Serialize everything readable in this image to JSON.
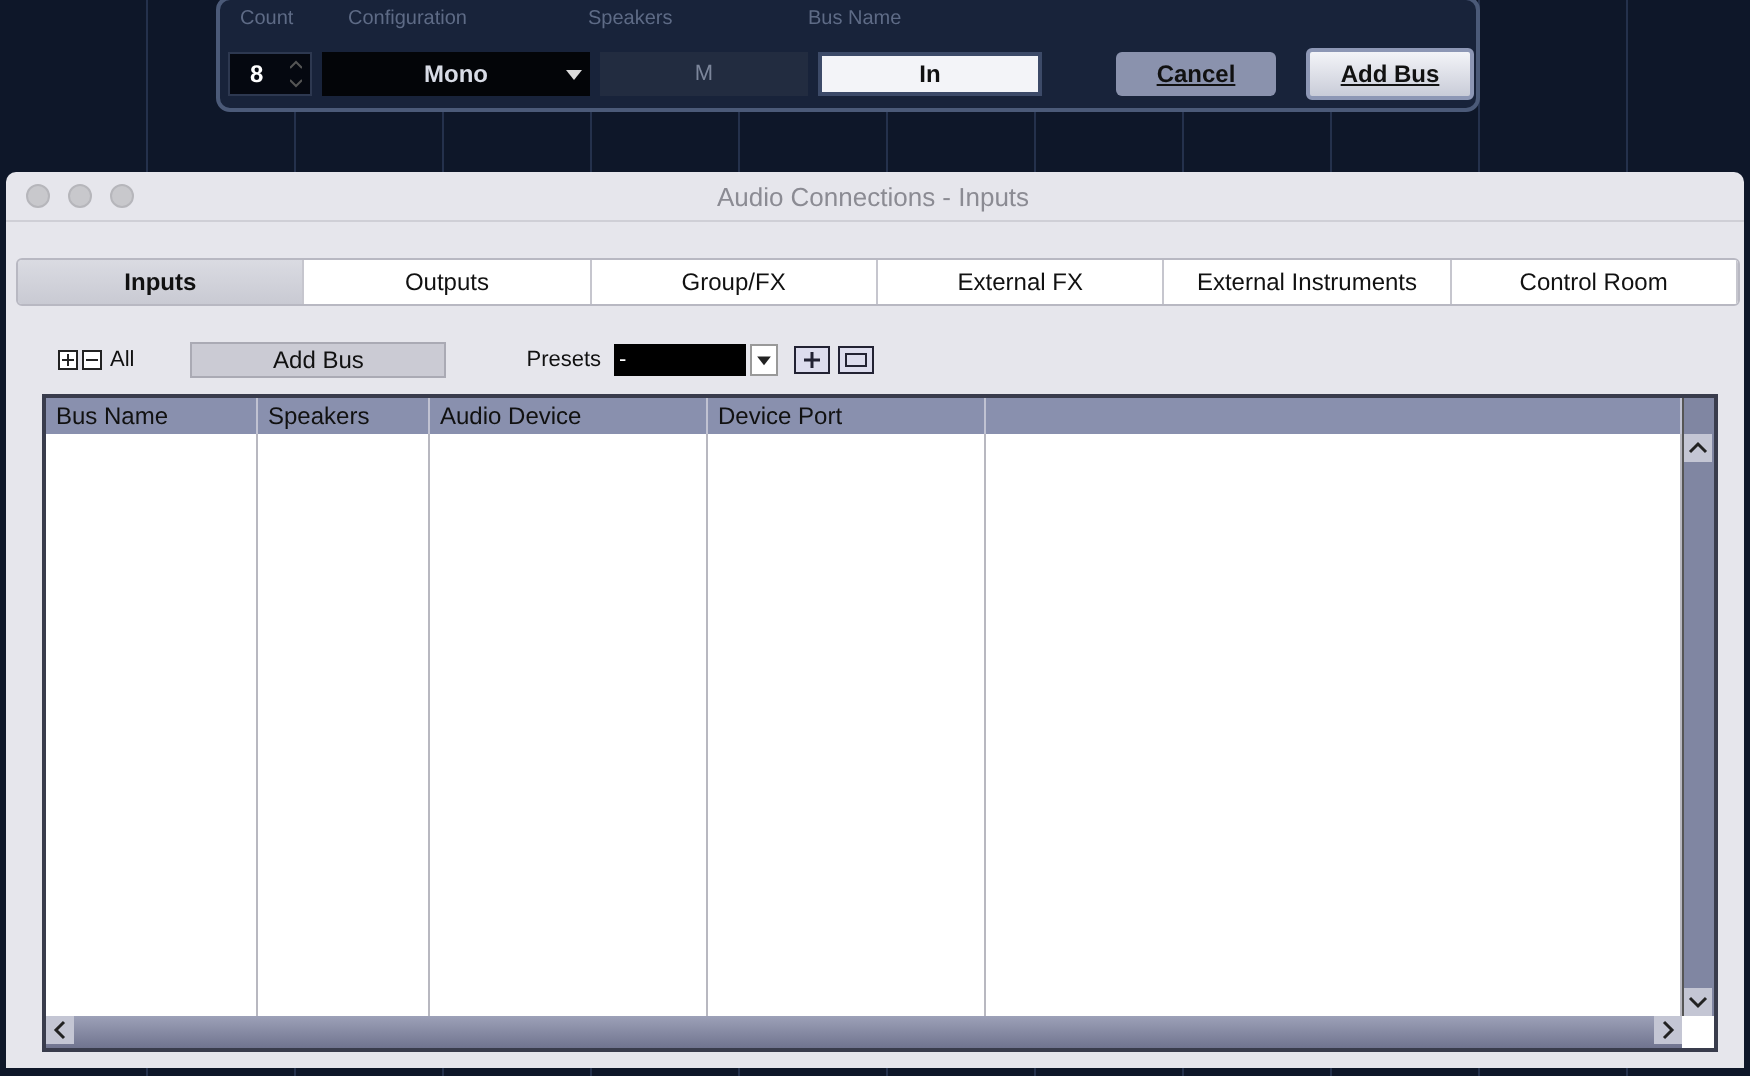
{
  "add_bus_dialog": {
    "fields": [
      {
        "label": "Count",
        "kind": "spinner",
        "value": "8"
      },
      {
        "label": "Configuration",
        "kind": "dropdown",
        "value": "Mono"
      },
      {
        "label": "Speakers",
        "kind": "readonly",
        "value": "M"
      },
      {
        "label": "Bus Name",
        "kind": "text",
        "value": "In"
      }
    ],
    "buttons": [
      {
        "label": "Cancel",
        "default": false
      },
      {
        "label": "Add Bus",
        "default": true
      }
    ]
  },
  "window": {
    "title": "Audio Connections - Inputs"
  },
  "tabs": [
    {
      "label": "Inputs",
      "selected": true
    },
    {
      "label": "Outputs",
      "selected": false
    },
    {
      "label": "Group/FX",
      "selected": false
    },
    {
      "label": "External FX",
      "selected": false
    },
    {
      "label": "External Instruments",
      "selected": false
    },
    {
      "label": "Control Room",
      "selected": false
    }
  ],
  "toolbar": {
    "expand_label": "All",
    "add_button": "Add Bus",
    "presets_label": "Presets",
    "presets_value": "-"
  },
  "table": {
    "columns": [
      "Bus Name",
      "Speakers",
      "Audio Device",
      "Device Port"
    ]
  }
}
